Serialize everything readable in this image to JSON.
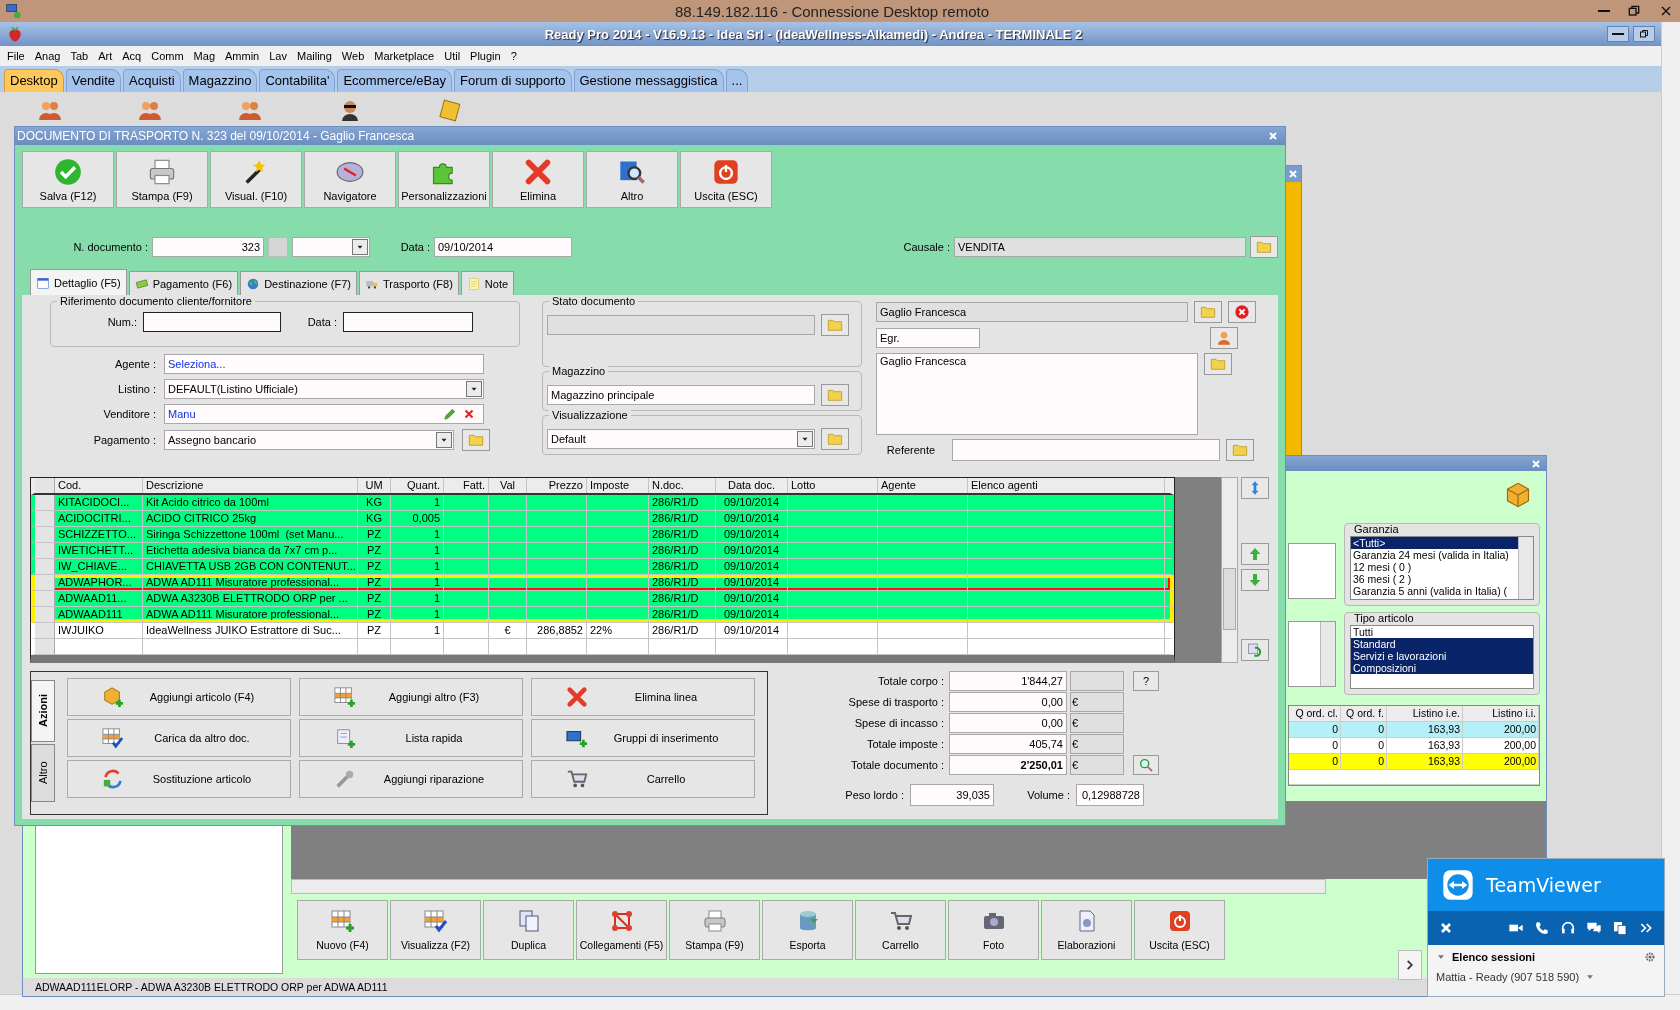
{
  "remote_title": "88.149.182.116 - Connessione Desktop remoto",
  "app_title": "Ready Pro 2014 - V16.9.13 - Idea Srl - (IdeaWellness-Alkamedi) - Andrea - TERMINALE 2",
  "menu": [
    "File",
    "Anag",
    "Tab",
    "Art",
    "Acq",
    "Comm",
    "Mag",
    "Ammin",
    "Lav",
    "Mailing",
    "Web",
    "Marketplace",
    "Util",
    "Plugin",
    "?"
  ],
  "tabs": [
    {
      "label": "Desktop",
      "selected": true
    },
    {
      "label": "Vendite",
      "selected": false
    },
    {
      "label": "Acquisti",
      "selected": false
    },
    {
      "label": "Magazzino",
      "selected": false
    },
    {
      "label": "Contabilita'",
      "selected": false
    },
    {
      "label": "Ecommerce/eBay",
      "selected": false
    },
    {
      "label": "Forum di supporto",
      "selected": false
    },
    {
      "label": "Gestione messaggistica",
      "selected": false
    },
    {
      "label": "...",
      "selected": false
    }
  ],
  "dialog": {
    "title": "DOCUMENTO DI TRASPORTO N. 323 del 09/10/2014 - Gaglio Francesca",
    "toolbar": [
      "Salva (F12)",
      "Stampa (F9)",
      "Visual. (F10)",
      "Navigatore",
      "Personalizzazioni",
      "Elimina",
      "Altro",
      "Uscita (ESC)"
    ],
    "doc_number_label": "N. documento :",
    "doc_number": "323",
    "date_label": "Data :",
    "date": "09/10/2014",
    "causale_label": "Causale :",
    "causale": "VENDITA",
    "tabs": [
      {
        "label": "Dettaglio (F5)",
        "selected": true
      },
      {
        "label": "Pagamento (F6)",
        "selected": false
      },
      {
        "label": "Destinazione (F7)",
        "selected": false
      },
      {
        "label": "Trasporto (F8)",
        "selected": false
      },
      {
        "label": "Note",
        "selected": false
      }
    ],
    "reference": {
      "title": "Riferimento documento cliente/fornitore",
      "num_label": "Num.:",
      "date_label": "Data :"
    },
    "agente": {
      "label": "Agente :",
      "value": "Seleziona..."
    },
    "listino": {
      "label": "Listino :",
      "value": "DEFAULT(Listino Ufficiale)"
    },
    "venditore": {
      "label": "Venditore :",
      "value": "Manu"
    },
    "pagamento": {
      "label": "Pagamento :",
      "value": "Assegno bancario"
    },
    "stato": {
      "title": "Stato documento"
    },
    "magazzino": {
      "title": "Magazzino",
      "value": "Magazzino principale"
    },
    "visualizzazione": {
      "title": "Visualizzazione",
      "value": "Default"
    },
    "customer": {
      "name": "Gaglio Francesca",
      "salutation": "Egr.",
      "address": "Gaglio Francesca",
      "referente_label": "Referente"
    },
    "table": {
      "columns": [
        "Cod.",
        "Descrizione",
        "UM",
        "Quant.",
        "Fatt.",
        "Val",
        "Prezzo",
        "Imposte",
        "N.doc.",
        "Data doc.",
        "Lotto",
        "Agente",
        "Elenco agenti"
      ],
      "rows": [
        {
          "cod": "KITACIDOCI...",
          "desc": "Kit Acido citrico da 100ml",
          "um": "KG",
          "quant": "1",
          "ndoc": "286/R1/D",
          "data": "09/10/2014",
          "color": "#00ff80",
          "selected": false,
          "highlighted": false
        },
        {
          "cod": "ACIDOCITRI...",
          "desc": "ACIDO CITRICO 25kg",
          "um": "KG",
          "quant": "0,005",
          "ndoc": "286/R1/D",
          "data": "09/10/2014",
          "color": "#00ff80",
          "selected": false,
          "highlighted": false
        },
        {
          "cod": "SCHIZZETTO...",
          "desc": "Siringa Schizzettone 100ml  (set Manu...",
          "um": "PZ",
          "quant": "1",
          "ndoc": "286/R1/D",
          "data": "09/10/2014",
          "color": "#00ff80",
          "selected": false,
          "highlighted": false
        },
        {
          "cod": "IWETICHETT...",
          "desc": "Etichetta adesiva bianca da 7x7 cm p...",
          "um": "PZ",
          "quant": "1",
          "ndoc": "286/R1/D",
          "data": "09/10/2014",
          "color": "#00ff80",
          "selected": false,
          "highlighted": false
        },
        {
          "cod": "IW_CHIAVE...",
          "desc": "CHIAVETTA USB 2GB CON CONTENUT...",
          "um": "PZ",
          "quant": "1",
          "ndoc": "286/R1/D",
          "data": "09/10/2014",
          "color": "#00ff80",
          "selected": false,
          "highlighted": false
        },
        {
          "cod": "ADWAPHOR...",
          "desc": "ADWA AD111 Misuratore professional...",
          "um": "PZ",
          "quant": "1",
          "ndoc": "286/R1/D",
          "data": "09/10/2014",
          "color": "#00ff80",
          "selected": true,
          "highlighted": true
        },
        {
          "cod": "ADWAAD11...",
          "desc": "ADWA A3230B ELETTRODO ORP per ...",
          "um": "PZ",
          "quant": "1",
          "ndoc": "286/R1/D",
          "data": "09/10/2014",
          "color": "#00ff80",
          "selected": false,
          "highlighted": true
        },
        {
          "cod": "ADWAAD111",
          "desc": "ADWA AD111 Misuratore professional...",
          "um": "PZ",
          "quant": "1",
          "ndoc": "286/R1/D",
          "data": "09/10/2014",
          "color": "#00ff80",
          "selected": false,
          "highlighted": true
        },
        {
          "cod": "IWJUIKO",
          "desc": "IdeaWellness JUIKO Estrattore di Suc...",
          "um": "PZ",
          "quant": "1",
          "val": "€",
          "prezzo": "286,8852",
          "imposte": "22%",
          "ndoc": "286/R1/D",
          "data": "09/10/2014",
          "color": "#ffffff",
          "selected": false,
          "highlighted": false
        }
      ]
    },
    "action_tabs": [
      {
        "label": "Azioni",
        "selected": true
      },
      {
        "label": "Altro",
        "selected": false
      }
    ],
    "actions": [
      "Aggiungi articolo (F4)",
      "Aggiungi altro (F3)",
      "Elimina linea",
      "Carica da altro doc.",
      "Lista rapida",
      "Gruppi di inserimento",
      "Sostituzione articolo",
      "Aggiungi riparazione",
      "Carrello"
    ],
    "totals": [
      {
        "label": "Totale corpo :",
        "value": "1'844,27",
        "kind": "help",
        "button": "?",
        "bold": false
      },
      {
        "label": "Spese di trasporto :",
        "value": "0,00",
        "kind": "currency",
        "currency": "€",
        "bold": false
      },
      {
        "label": "Spese di incasso :",
        "value": "0,00",
        "kind": "currency",
        "currency": "€",
        "bold": false
      },
      {
        "label": "Totale imposte :",
        "value": "405,74",
        "kind": "currency",
        "currency": "€",
        "bold": false
      },
      {
        "label": "Totale documento :",
        "value": "2'250,01",
        "kind": "zoom",
        "currency": "€",
        "bold": true
      }
    ],
    "peso": {
      "label": "Peso lordo :",
      "value": "39,035"
    },
    "volume": {
      "label": "Volume :",
      "value": "0,12988728"
    }
  },
  "back_window": {
    "garanzia": {
      "title": "Garanzia",
      "items": [
        {
          "label": "<Tutti>",
          "selected": true
        },
        {
          "label": "Garanzia 24 mesi (valida in Italia)",
          "selected": false
        },
        {
          "label": "12 mesi ( 0 )",
          "selected": false
        },
        {
          "label": "36 mesi ( 2 )",
          "selected": false
        },
        {
          "label": "Garanzia 5 anni (valida in Italia) (",
          "selected": false
        }
      ]
    },
    "tipo": {
      "title": "Tipo articolo",
      "items": [
        {
          "label": "Tutti",
          "selected": false
        },
        {
          "label": "Standard",
          "selected": true
        },
        {
          "label": "Servizi e lavorazioni",
          "selected": true
        },
        {
          "label": "Composizioni",
          "selected": true
        }
      ]
    },
    "table": {
      "columns": [
        "Q ord. cl.",
        "Q ord. f.",
        "Listino i.e.",
        "Listino i.i."
      ],
      "rows": [
        {
          "color": "#b4f0f8",
          "cells": [
            "0",
            "0",
            "163,93",
            "200,00"
          ]
        },
        {
          "color": "#ffffff",
          "cells": [
            "0",
            "0",
            "163,93",
            "200,00"
          ]
        },
        {
          "color": "#ffff00",
          "cells": [
            "0",
            "0",
            "163,93",
            "200,00"
          ]
        }
      ]
    },
    "toolbar": [
      "Nuovo (F4)",
      "Visualizza (F2)",
      "Duplica",
      "Collegamenti (F5)",
      "Stampa (F9)",
      "Esporta",
      "Carrello",
      "Foto",
      "Elaborazioni",
      "Uscita (ESC)"
    ],
    "status": "ADWAAD111ELORP - ADWA A3230B ELETTRODO ORP per ADWA AD111"
  },
  "teamviewer": {
    "title": "TeamViewer",
    "sessions_label": "Elenco sessioni",
    "session": "Mattia - Ready (907 518 590)"
  }
}
